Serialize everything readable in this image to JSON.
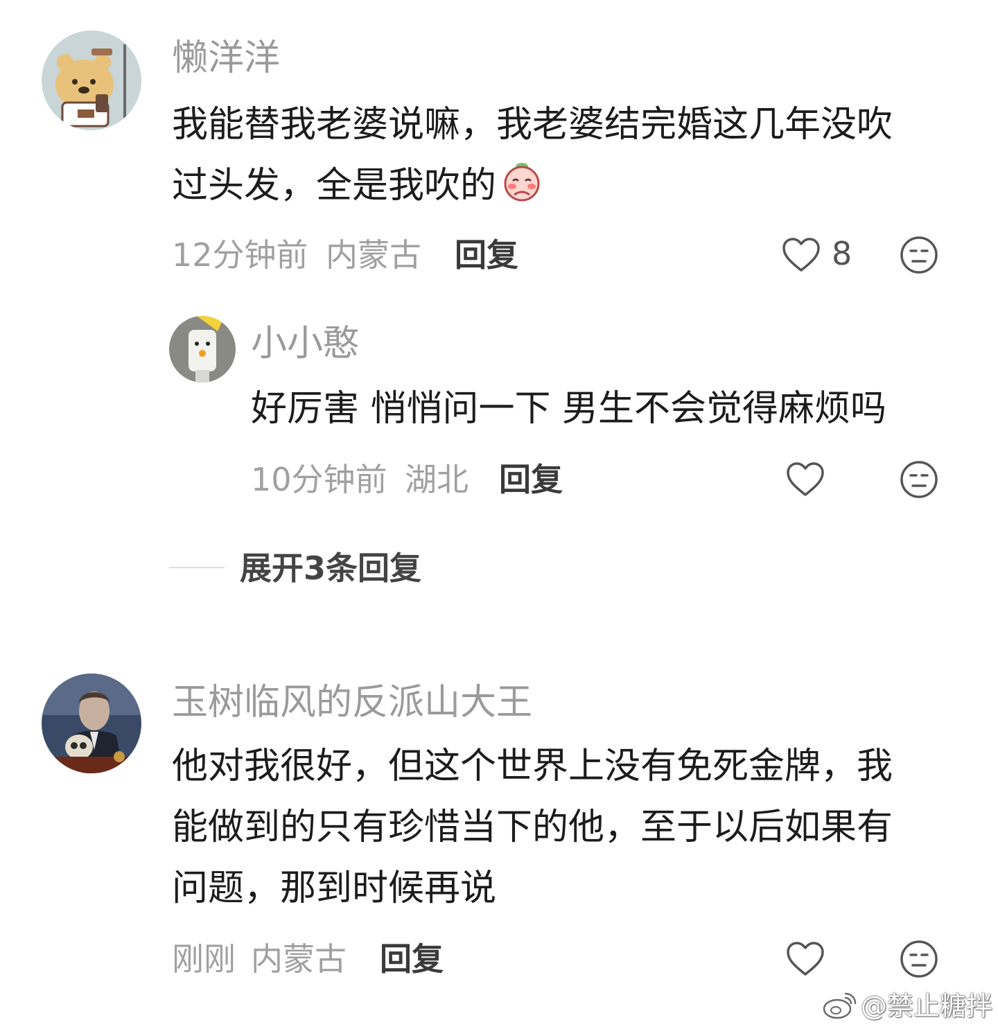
{
  "comments": [
    {
      "username": "懒洋洋",
      "avatar": "bear-drinking-coffee-avatar",
      "content_lines": [
        "我能替我老婆说嘛，我老婆结完婚这几年没吹",
        "过头发，全是我吹的"
      ],
      "emoji": "shy-peach-emoji",
      "time": "12分钟前",
      "location": "内蒙古",
      "reply_label": "回复",
      "like_count": "8"
    },
    {
      "username": "小小憨",
      "avatar": "toy-figure-avatar",
      "content_lines": [
        "好厉害 悄悄问一下 男生不会觉得麻烦吗"
      ],
      "time": "10分钟前",
      "location": "湖北",
      "reply_label": "回复"
    },
    {
      "username": "玉树临风的反派山大王",
      "avatar": "man-in-suit-avatar",
      "content_lines": [
        "他对我很好，但这个世界上没有免死金牌，我",
        "能做到的只有珍惜当下的他，至于以后如果有",
        "问题，那到时候再说"
      ],
      "time": "刚刚",
      "location": "内蒙古",
      "reply_label": "回复"
    }
  ],
  "expand_replies": "展开3条回复",
  "watermark": "@禁止糖拌",
  "icons": {
    "like": "heart-outline-icon",
    "dislike": "meh-face-icon",
    "weibo": "weibo-logo-icon"
  },
  "colors": {
    "name": "#9a9a9a",
    "content": "#1c1c1c",
    "meta": "#a0a0a0",
    "reply": "#3a3a3a"
  }
}
